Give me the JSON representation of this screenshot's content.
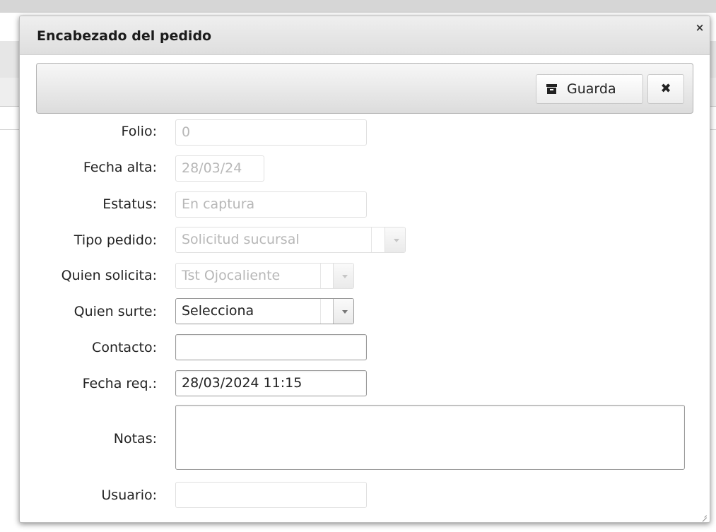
{
  "dialog": {
    "title": "Encabezado del pedido",
    "close_glyph": "×"
  },
  "toolbar": {
    "save_label": "Guarda",
    "save_icon": "archive-icon",
    "close_glyph": "✖"
  },
  "form": {
    "folio": {
      "label": "Folio:",
      "value": "0"
    },
    "fecha_alta": {
      "label": "Fecha alta:",
      "value": "28/03/24"
    },
    "estatus": {
      "label": "Estatus:",
      "value": "En captura"
    },
    "tipo_pedido": {
      "label": "Tipo pedido:",
      "value": "Solicitud sucursal"
    },
    "quien_solicita": {
      "label": "Quien solicita:",
      "value": "Tst Ojocaliente"
    },
    "quien_surte": {
      "label": "Quien surte:",
      "value": "Selecciona"
    },
    "contacto": {
      "label": "Contacto:",
      "value": ""
    },
    "fecha_req": {
      "label": "Fecha req.:",
      "value": "28/03/2024 11:15"
    },
    "notas": {
      "label": "Notas:",
      "value": ""
    },
    "usuario": {
      "label": "Usuario:",
      "value": ""
    }
  }
}
